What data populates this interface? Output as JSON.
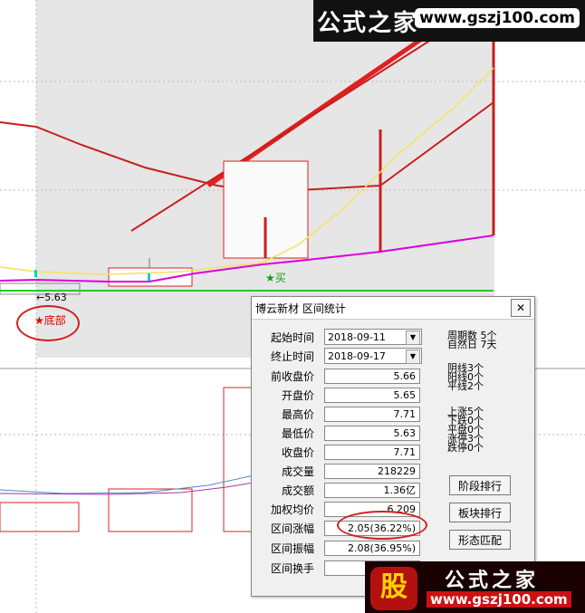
{
  "watermark": {
    "brand": "公式之家",
    "url": "www.gszj100.com"
  },
  "chart": {
    "low_label": "←5.63",
    "bottom_label": "★底部",
    "buy_label": "★买",
    "colors": {
      "up": "#d02020",
      "purple": "#dd00dd",
      "yellow": "#ffee55",
      "green": "#22cc22",
      "cyan": "#00cccc"
    }
  },
  "dialog": {
    "title": "博云新材 区间统计",
    "close": "✕",
    "start_label": "起始时间",
    "start_value": "2018-09-11",
    "end_label": "终止时间",
    "end_value": "2018-09-17",
    "rows": [
      {
        "label": "前收盘价",
        "value": "5.66"
      },
      {
        "label": "开盘价",
        "value": "5.65"
      },
      {
        "label": "最高价",
        "value": "7.71"
      },
      {
        "label": "最低价",
        "value": "5.63"
      },
      {
        "label": "收盘价",
        "value": "7.71"
      },
      {
        "label": "成交量",
        "value": "218229"
      },
      {
        "label": "成交额",
        "value": "1.36亿"
      },
      {
        "label": "加权均价",
        "value": "6.209"
      },
      {
        "label": "区间涨幅",
        "value": "2.05(36.22%)"
      },
      {
        "label": "区间振幅",
        "value": "2.08(36.95%)"
      },
      {
        "label": "区间换手",
        "value": ""
      }
    ],
    "period": [
      {
        "label": "周期数",
        "value": "5个"
      },
      {
        "label": "自然日",
        "value": "7天"
      }
    ],
    "candles": [
      {
        "label": "阴线",
        "value": "3个"
      },
      {
        "label": "阳线",
        "value": "0个"
      },
      {
        "label": "平线",
        "value": "2个"
      }
    ],
    "moves": [
      {
        "label": "上涨",
        "value": "5个"
      },
      {
        "label": "下跌",
        "value": "0个"
      },
      {
        "label": "平盘",
        "value": "0个"
      },
      {
        "label": "涨停",
        "value": "3个"
      },
      {
        "label": "跌停",
        "value": "0个"
      }
    ],
    "buttons": {
      "stage_rank": "阶段排行",
      "sector_rank": "板块排行",
      "pattern_match": "形态匹配"
    }
  }
}
